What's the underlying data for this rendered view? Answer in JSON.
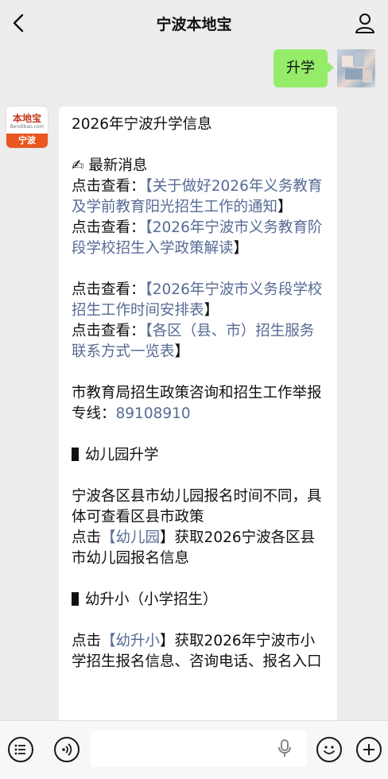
{
  "header": {
    "title": "宁波本地宝"
  },
  "user_message": {
    "text": "升学"
  },
  "bot": {
    "avatar": {
      "logo_text": "本地宝",
      "logo_url": "Bendibao.com",
      "city": "宁波"
    },
    "message": {
      "heading": "2026年宁波升学信息",
      "latest_icon": "✍",
      "latest_label": "最新消息",
      "click_view": "点击查看：",
      "link1": "【关于做好2026年义务教育及学前教育阳光招生工作的通知",
      "link1_end": "】",
      "link2": "【2026年宁波市义务教育阶段学校招生入学政策解读",
      "link2_end": "】",
      "link3": "【2026年宁波市义务段学校招生工作时间安排表",
      "link3_end": "】",
      "link4": "【各区（县、市）招生服务联系方式一览表",
      "link4_end": "】",
      "hotline_text": "市教育局招生政策咨询和招生工作举报专线：",
      "hotline_number": "89108910",
      "section1_title": "幼儿园升学",
      "section1_text": "宁波各区县市幼儿园报名时间不同，具体可查看区县市政策",
      "click": "点击",
      "section1_link": "【幼儿园",
      "section1_link_end": "】",
      "section1_after": "获取2026宁波各区县市幼儿园报名信息",
      "section2_title": "幼升小（小学招生）",
      "section2_link": "【幼升小",
      "section2_link_end": "】",
      "section2_after": "获取2026年宁波市小学招生报名信息、咨询电话、报名入口"
    }
  },
  "bottom_bar": {
    "icons": [
      "menu-icon",
      "voice-icon",
      "microphone-icon",
      "emoji-icon",
      "add-icon"
    ]
  }
}
